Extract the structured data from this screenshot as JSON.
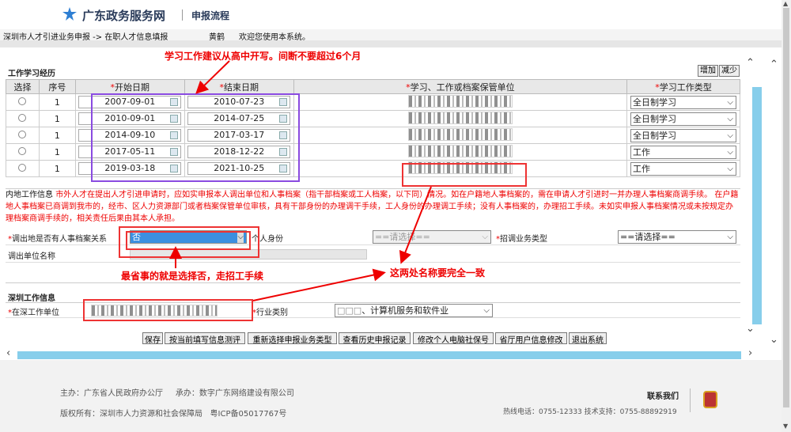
{
  "header": {
    "site_name": "广东政务服务网",
    "page_title": "申报流程"
  },
  "crumbbar": {
    "breadcrumb": "深圳市人才引进业务申报 -> 在职人才信息填报",
    "user": "黄鹤",
    "welcome": "欢迎您使用本系统。"
  },
  "annotations": {
    "top": "学习工作建议从高中开写。间断不要超过6个月",
    "choose_no": "最省事的就是选择否，走招工手续",
    "names_match": "这两处名称要完全一致"
  },
  "work_section": {
    "title": "工作学习经历",
    "add_label": "增加",
    "remove_label": "减少",
    "columns": [
      "选择",
      "序号",
      "开始日期",
      "结束日期",
      "学习、工作或档案保管单位",
      "学习工作类型"
    ],
    "rows": [
      {
        "seq": "1",
        "start": "2007-09-01",
        "end": "2010-07-23",
        "type": "全日制学习"
      },
      {
        "seq": "1",
        "start": "2010-09-01",
        "end": "2014-07-25",
        "type": "全日制学习"
      },
      {
        "seq": "1",
        "start": "2014-09-10",
        "end": "2017-03-17",
        "type": "全日制学习"
      },
      {
        "seq": "1",
        "start": "2017-05-11",
        "end": "2018-12-22",
        "type": "工作"
      },
      {
        "seq": "1",
        "start": "2019-03-18",
        "end": "2021-10-25",
        "type": "工作"
      }
    ]
  },
  "note": {
    "label": "内地工作信息",
    "text": "市外人才在提出人才引进申请时，应如实申报本人调出单位和人事档案（指干部档案或工人档案，以下同）情况。如在户籍地人事档案的，需在申请人才引进时一并办理人事档案商调手续。 在户籍地人事档案已商调到我市的，经市、区人力资源部门或者档案保管单位审核，具有干部身份的办理调干手续，工人身份的办理调工手续；没有人事档案的，办理招工手续。未如实申报人事档案情况或未按规定办理档案商调手续的，相关责任后果由其本人承担。"
  },
  "transfer": {
    "label": "调出地是否有人事档案关系",
    "value": "否",
    "identity_label": "个人身份",
    "identity_placeholder": "==请选择==",
    "biz_label": "招调业务类型",
    "biz_placeholder": "==请选择==",
    "unit_label": "调出单位名称"
  },
  "shenzhen": {
    "title": "深圳工作信息",
    "unit_label": "在深工作单位",
    "industry_label": "行业类别",
    "industry_value": "、计算机服务和软件业"
  },
  "buttons": [
    "保存",
    "按当前填写信息测评",
    "重新选择申报业务类型",
    "查看历史申报记录",
    "修改个人电脑社保号",
    "省厅用户信息修改",
    "退出系统"
  ],
  "footer": {
    "organizer": "主办：广东省人民政府办公厅",
    "undertaker": "承办：数字广东网络建设有限公司",
    "copyright": "版权所有：深圳市人力资源和社会保障局",
    "icp": "粤ICP备05017767号",
    "contact": "联系我们",
    "hotline": "热线电话：0755-12333 技术支持：0755-88892919"
  },
  "colors": {
    "required": "#ee0000",
    "annotation": "#ee0000",
    "highlight_box": "#8a4be0",
    "scroll_accent": "#87ceeb"
  }
}
